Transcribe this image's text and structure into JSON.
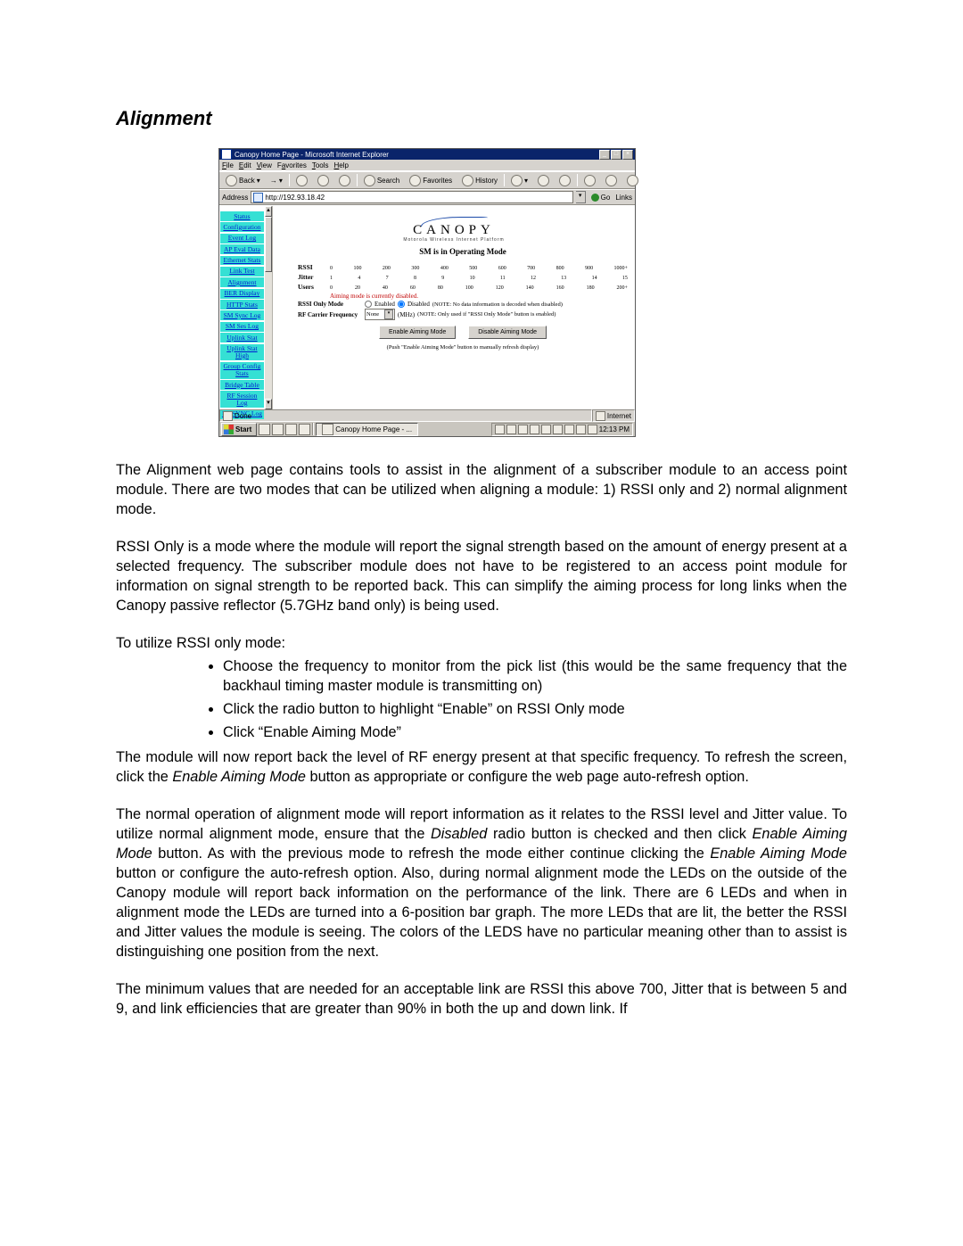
{
  "doc": {
    "heading": "Alignment",
    "p1": "The Alignment web page contains tools to assist in the alignment of a subscriber module to an access point module.  There are two modes that can be utilized when aligning a module: 1) RSSI only and 2) normal alignment mode.",
    "p2": "RSSI Only is a mode where the module will report the signal strength based on the amount of energy present at a selected frequency.  The subscriber module does not have to be registered to an access point module for information on signal strength to be reported back. This can simplify the aiming process for long links when the Canopy passive reflector (5.7GHz band only) is being used.",
    "p3": "To utilize RSSI only mode:",
    "bullets": [
      "Choose the frequency to monitor from the pick list (this would be the same frequency that the backhaul timing master module is transmitting on)",
      "Click the radio button to highlight “Enable” on RSSI Only mode",
      "Click “Enable Aiming Mode”"
    ],
    "p4a": "The module will now report back the level of RF energy present at that specific frequency.  To refresh the screen, click the ",
    "p4b": " button as appropriate or configure the web page auto-refresh option.",
    "p5a": "The normal operation of alignment mode will report information as it relates to the RSSI level and Jitter value.  To utilize normal alignment mode, ensure that the ",
    "p5b": " radio button is checked and then click ",
    "p5c": " button.  As with the previous mode to refresh the mode either continue clicking the ",
    "p5d": " button or configure the auto-refresh option.  Also, during normal alignment mode the LEDs on the outside of the Canopy module will report back information on the performance of the link.  There are 6 LEDs and when in alignment mode the LEDs are turned into a 6-position bar graph.  The more LEDs that are lit, the better the RSSI and Jitter values the module is seeing.  The colors of the LEDS have no particular meaning other than to assist is distinguishing one position from the next.",
    "p6": "The minimum values that are needed for an acceptable link are RSSI this above 700, Jitter that is between 5 and 9, and link efficiencies that are greater than 90% in both the up and down link. If",
    "kw_enable": "Enable",
    "kw_eam": "Enable Aiming Mode",
    "kw_disabled": "Disabled"
  },
  "ie": {
    "title": "Canopy Home Page - Microsoft Internet Explorer",
    "menus": [
      "File",
      "Edit",
      "View",
      "Favorites",
      "Tools",
      "Help"
    ],
    "back": "Back",
    "search": "Search",
    "favorites": "Favorites",
    "history": "History",
    "address_label": "Address",
    "address_value": "http://192.93.18.42",
    "go": "Go",
    "links": "Links",
    "status_done": "Done",
    "status_zone": "Internet",
    "taskbar_start": "Start",
    "taskbar_app": "Canopy Home Page - ...",
    "taskbar_time": "12:13 PM"
  },
  "canopy": {
    "logo_word": "CANOPY",
    "logo_sub": "Motorola Wireless Internet Platform",
    "nav": [
      "Status",
      "Configuration",
      "Event Log",
      "AP Eval Data",
      "Ethernet Stats",
      "Link Test",
      "Alignment",
      "BER Display",
      "HTTP Stats",
      "SM Sync Log",
      "SM Ses Log",
      "Uplink Stat",
      "Uplink Stat High",
      "Group Config Stats",
      "Bridge Table",
      "RF Session Log",
      "RF SYNC Log"
    ],
    "mode_line": "SM is in Operating Mode",
    "scales": {
      "rssi_label": "RSSI",
      "rssi_ticks": [
        "0",
        "100",
        "200",
        "300",
        "400",
        "500",
        "600",
        "700",
        "800",
        "900",
        "1000+"
      ],
      "jitter_label": "Jitter",
      "jitter_ticks": [
        "1",
        "4",
        "7",
        "8",
        "9",
        "10",
        "11",
        "12",
        "13",
        "14",
        "15"
      ],
      "users_label": "Users",
      "users_ticks": [
        "0",
        "20",
        "40",
        "60",
        "80",
        "100",
        "120",
        "140",
        "160",
        "180",
        "200+"
      ]
    },
    "aiming_disabled": "Aiming mode is currently disabled.",
    "rssi_only_label": "RSSI Only Mode",
    "rssi_enabled": "Enabled",
    "rssi_disabled": "Disabled",
    "rssi_note": "(NOTE: No data information is decoded when disabled)",
    "rfcf_label": "RF Carrier Frequency",
    "rfcf_value": "None",
    "rfcf_unit": "(MHz)",
    "rfcf_note": "(NOTE: Only used if \"RSSI Only Mode\" button is enabled)",
    "btn_enable": "Enable Aiming Mode",
    "btn_disable": "Disable Aiming Mode",
    "hint": "(Push \"Enable Aiming Mode\" button to manually refresh display)"
  }
}
